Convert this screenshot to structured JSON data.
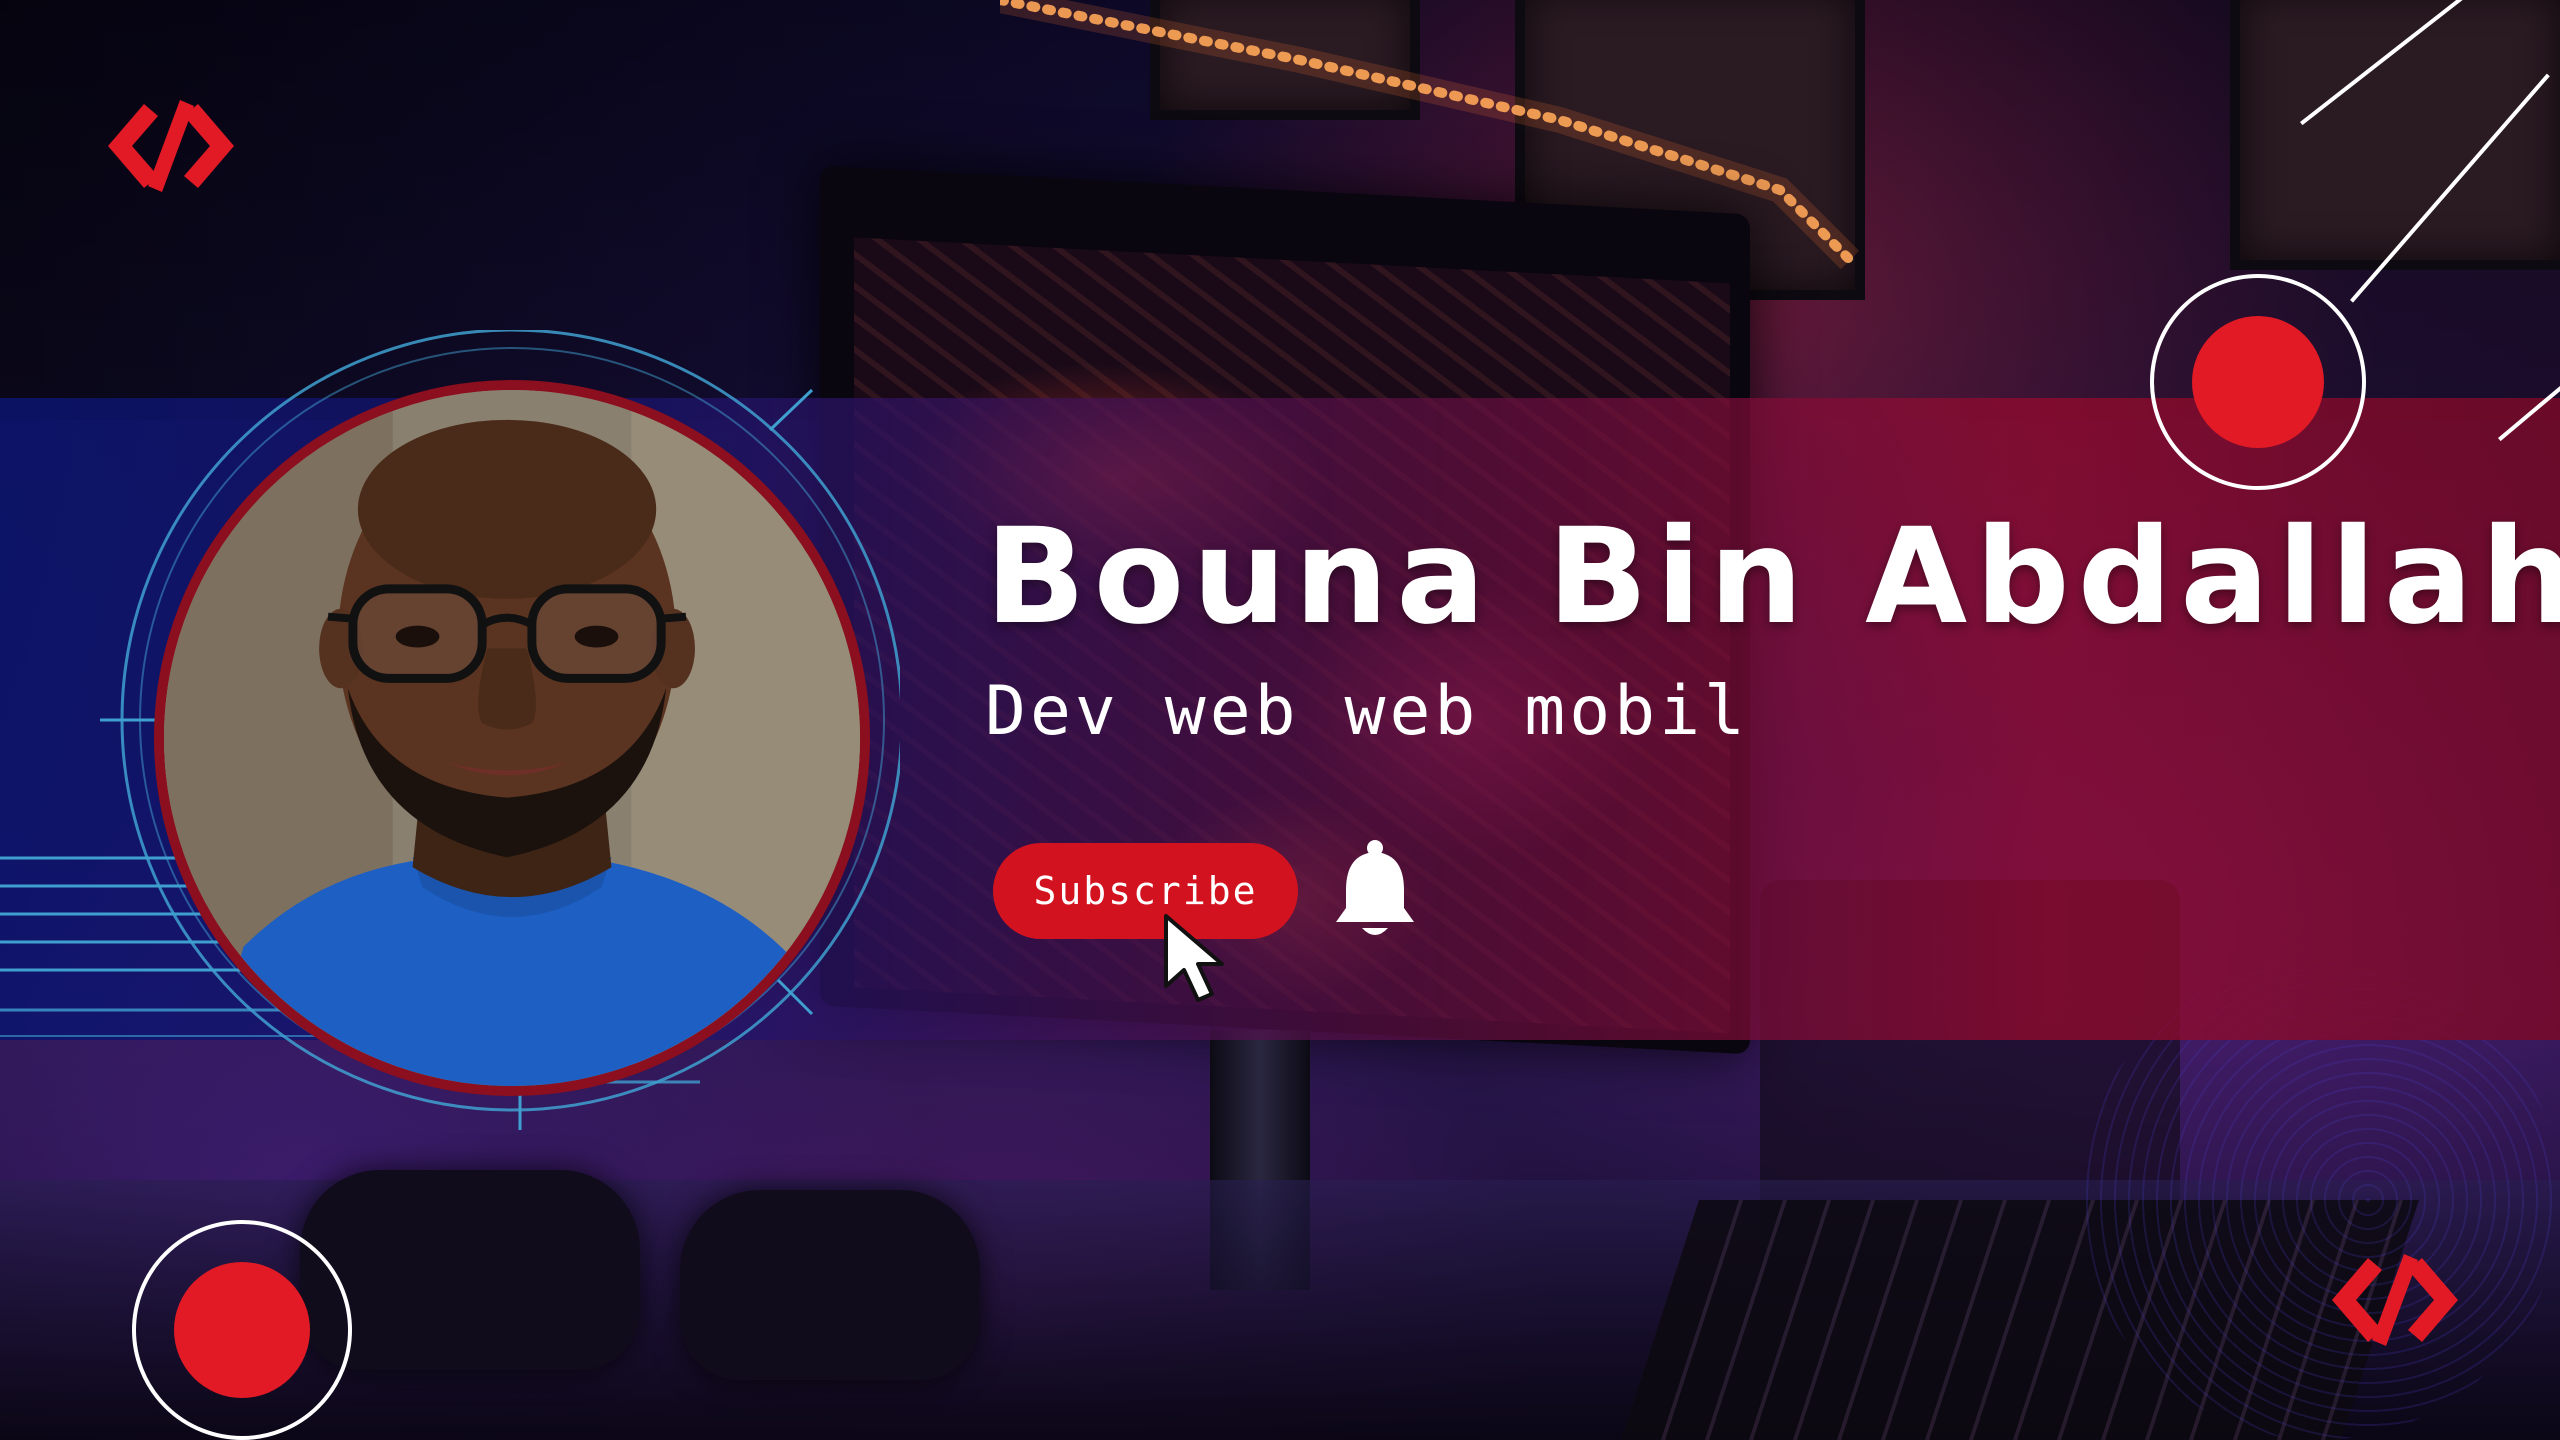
{
  "channel": {
    "name": "Bouna Bin Abdallah",
    "tagline": "Dev web web mobil"
  },
  "actions": {
    "subscribe_label": "Subscribe"
  },
  "icons": {
    "logo": "code-brackets-icon",
    "record": "record-icon",
    "bell": "bell-icon",
    "cursor": "cursor-icon"
  },
  "colors": {
    "accent_red": "#e11a25",
    "button_red": "#d3121f",
    "text": "#ffffff",
    "band_left": "#0a146e",
    "band_right": "#960a2d"
  }
}
